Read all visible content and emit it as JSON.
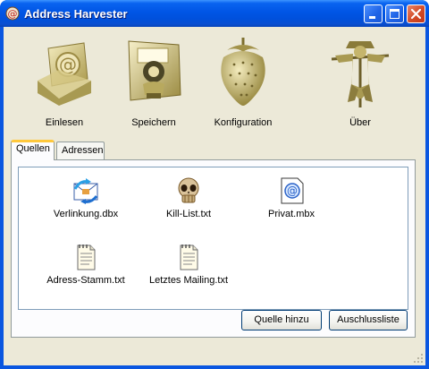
{
  "window": {
    "title": "Address Harvester"
  },
  "toolbar": {
    "items": [
      {
        "label": "Einlesen",
        "icon": "inbox-email-icon"
      },
      {
        "label": "Speichern",
        "icon": "save-disk-icon"
      },
      {
        "label": "Konfiguration",
        "icon": "strawberry-icon"
      },
      {
        "label": "Über",
        "icon": "scarecrow-icon"
      }
    ]
  },
  "tabs": [
    {
      "label": "Quellen",
      "active": true
    },
    {
      "label": "Adressen",
      "active": false
    }
  ],
  "sources": {
    "files": [
      {
        "name": "Verlinkung.dbx",
        "icon": "outlook-express-dbx-icon"
      },
      {
        "name": "Kill-List.txt",
        "icon": "skull-icon"
      },
      {
        "name": "Privat.mbx",
        "icon": "mailbox-file-icon"
      },
      {
        "name": "Adress-Stamm.txt",
        "icon": "text-file-icon"
      },
      {
        "name": "Letztes Mailing.txt",
        "icon": "text-file-icon"
      }
    ],
    "add_button": "Quelle hinzu",
    "exclusion_button": "Auschlussliste"
  },
  "colors": {
    "titlebar": "#0055e5",
    "client_bg": "#ece9d8",
    "tab_highlight": "#ffc83c",
    "icon_gold": "#c9b96a"
  }
}
